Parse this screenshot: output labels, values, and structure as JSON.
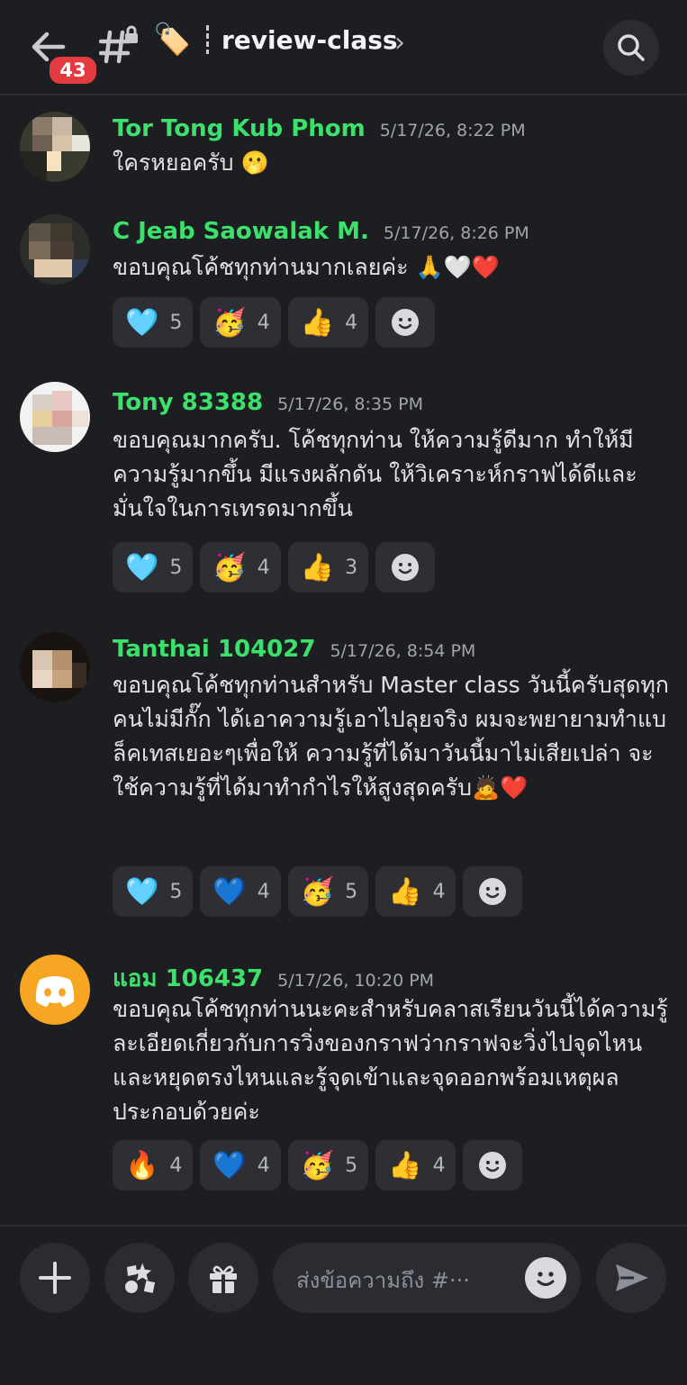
{
  "header": {
    "unread_count": "43",
    "channel_emoji": "🏷️",
    "channel_name": "review-class"
  },
  "messages": [
    {
      "username": "Tor Tong Kub Phom",
      "timestamp": "5/17/26, 8:22 PM",
      "text": "ใครหยอครับ 🫢",
      "reactions": []
    },
    {
      "username": "C Jeab Saowalak M.",
      "timestamp": "5/17/26, 8:26 PM",
      "text": "ขอบคุณโค้ชทุกท่านมากเลยค่ะ 🙏🤍❤️",
      "reactions": [
        {
          "emoji": "🩵",
          "count": "5"
        },
        {
          "emoji": "🥳",
          "count": "4"
        },
        {
          "emoji": "👍",
          "count": "4"
        }
      ]
    },
    {
      "username": "Tony 83388",
      "timestamp": "5/17/26, 8:35 PM",
      "text": "ขอบคุณมากครับ. โค้ชทุกท่าน ให้ความรู้ดีมาก ทำให้มีความรู้มากขึ้น มีแรงผลักดัน ให้วิเคราะห์กราฟได้ดีและมั่นใจในการเทรดมากขึ้น",
      "reactions": [
        {
          "emoji": "🩵",
          "count": "5"
        },
        {
          "emoji": "🥳",
          "count": "4"
        },
        {
          "emoji": "👍",
          "count": "3"
        }
      ]
    },
    {
      "username": "Tanthai 104027",
      "timestamp": "5/17/26, 8:54 PM",
      "text": "ขอบคุณโค้ชทุกท่านสำหรับ Master class วันนี้ครับสุดทุกคนไม่มีกั๊ก  ได้เอาความรู้เอาไปลุยจริง ผมจะพยายามทำแบล็คเทสเยอะๆเพื่อให้ ความรู้ที่ได้มาวันนี้มาไม่เสียเปล่า จะใช้ความรู้ที่ได้มาทำกำไรให้สูงสุดครับ🙇❤️",
      "reactions": [
        {
          "emoji": "🩵",
          "count": "5"
        },
        {
          "emoji": "💙",
          "count": "4"
        },
        {
          "emoji": "🥳",
          "count": "5"
        },
        {
          "emoji": "👍",
          "count": "4"
        }
      ]
    },
    {
      "username": "แอม 106437",
      "timestamp": "5/17/26, 10:20 PM",
      "text": "ขอบคุณโค้ชทุกท่านนะคะสำหรับคลาสเรียนวันนี้ได้ความรู้ละเอียดเกี่ยวกับการวิ่งของกราฟว่ากราฟจะวิ่งไปจุดไหนและหยุดตรงไหนและรู้จุดเข้าและจุดออกพร้อมเหตุผลประกอบด้วยค่ะ",
      "reactions": [
        {
          "emoji": "🔥",
          "count": "4"
        },
        {
          "emoji": "💙",
          "count": "4"
        },
        {
          "emoji": "🥳",
          "count": "5"
        },
        {
          "emoji": "👍",
          "count": "4"
        }
      ]
    }
  ],
  "composer": {
    "placeholder": "ส่งข้อความถึง #···"
  },
  "colors": {
    "background": "#1d1e22",
    "username": "#3ce16b",
    "badge": "#e23b40",
    "discord_avatar": "#f6a623"
  }
}
